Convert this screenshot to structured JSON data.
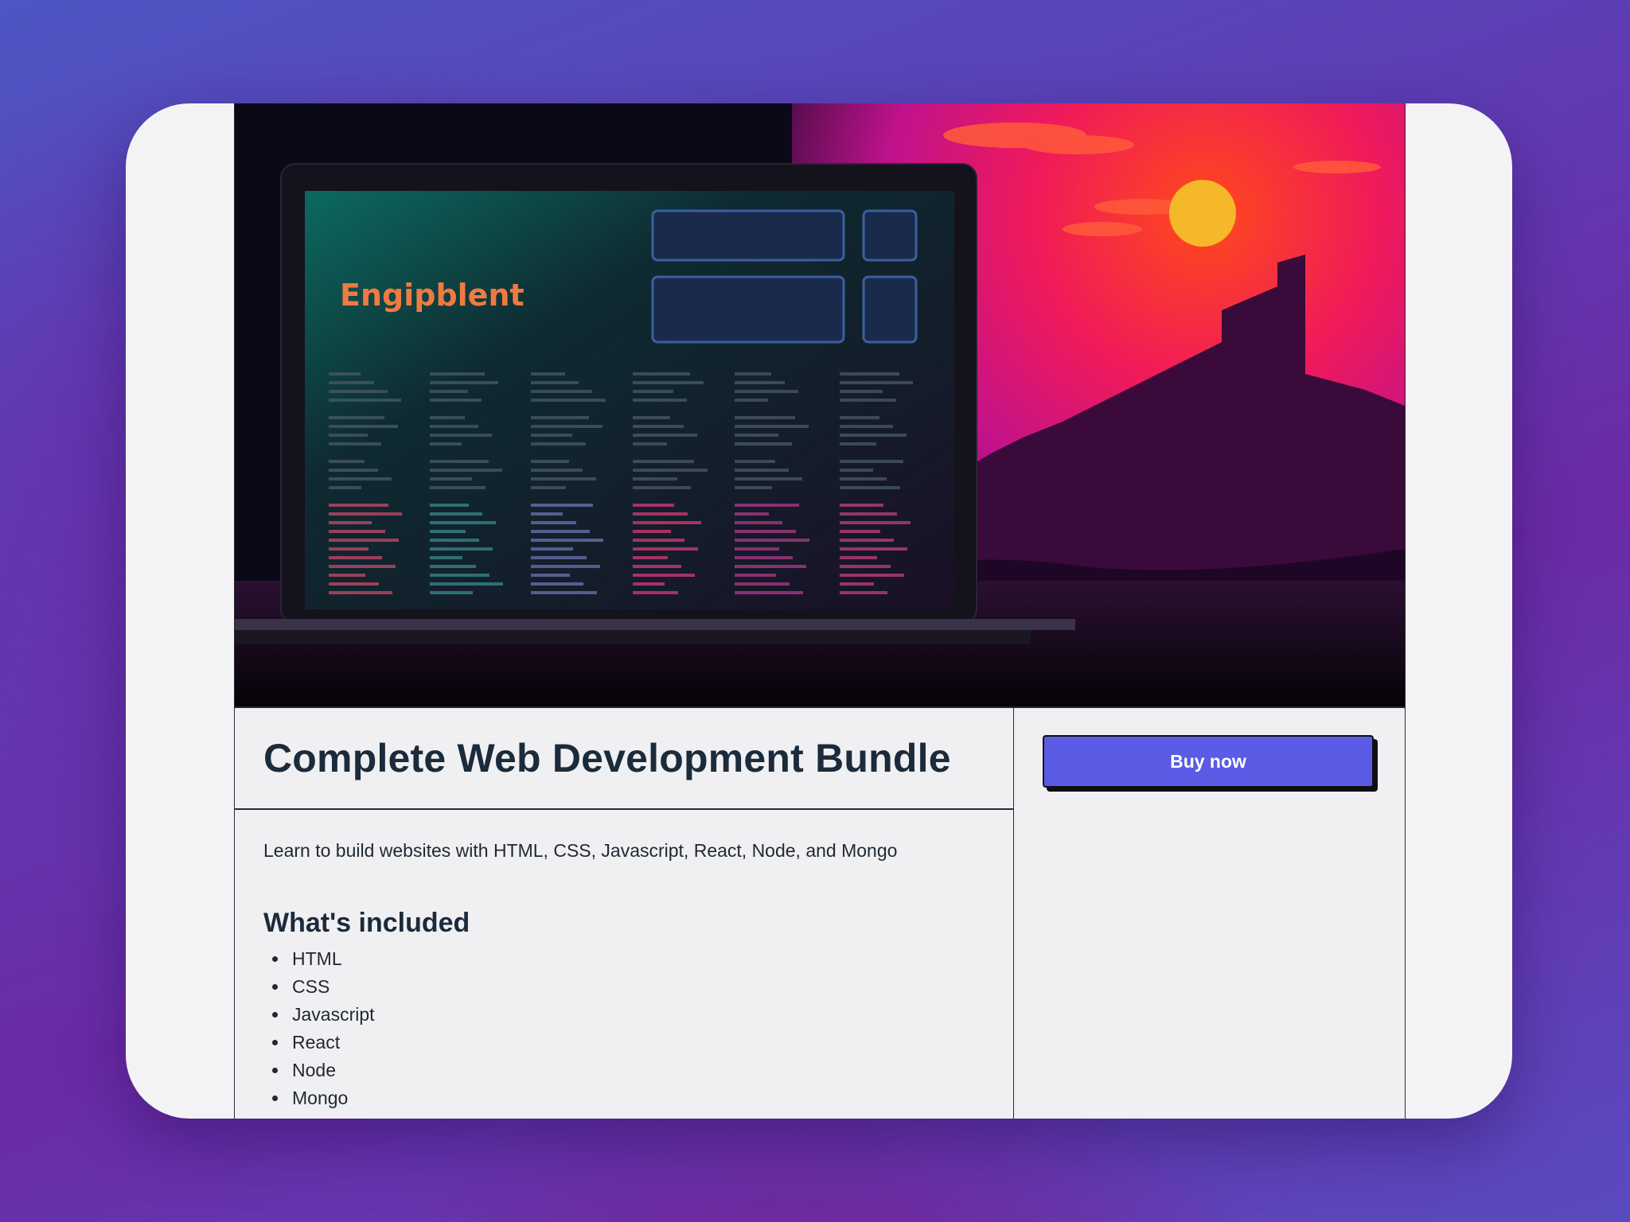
{
  "hero": {
    "screen_title": "Engipblent",
    "code_colors": [
      "#c94a6a",
      "#3a8a8c",
      "#6a74b0",
      "#d83a7a",
      "#b03a8a",
      "#c04080"
    ]
  },
  "product": {
    "title": "Complete Web Development Bundle",
    "description": "Learn to build websites with HTML, CSS, Javascript, React, Node, and Mongo",
    "included_heading": "What's included",
    "included_items": [
      "HTML",
      "CSS",
      "Javascript",
      "React",
      "Node",
      "Mongo"
    ]
  },
  "actions": {
    "buy_label": "Buy now"
  },
  "colors": {
    "accent": "#5b5be6",
    "title_text": "#1b2b3c",
    "page_bg": "#f0f0f2",
    "sun": "#f5b82a",
    "hero_sky_top": "#ff3a3a",
    "hero_sky_bottom": "#c8148c"
  }
}
